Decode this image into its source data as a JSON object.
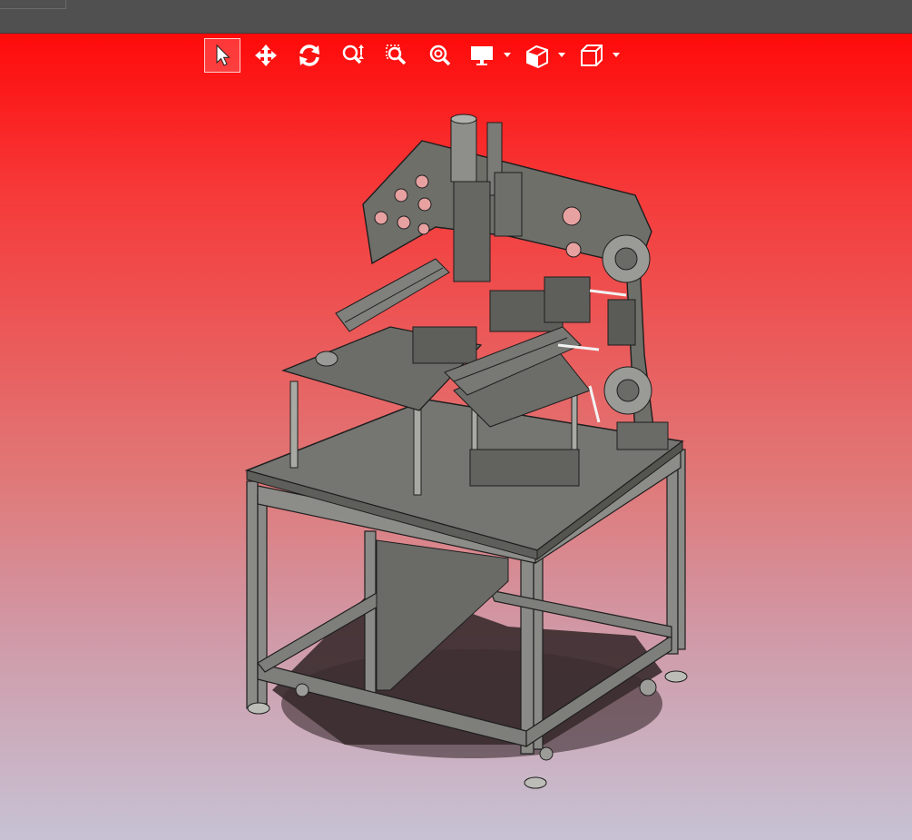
{
  "window": {
    "title_bar_color": "#505050"
  },
  "viewport": {
    "background_top": "#ff0a0a",
    "background_bottom": "#c6c2d4"
  },
  "toolbar": {
    "tools": [
      {
        "name": "select-tool",
        "icon": "cursor-arrow-icon",
        "active": true
      },
      {
        "name": "pan-tool",
        "icon": "move-arrows-icon",
        "active": false
      },
      {
        "name": "rotate-tool",
        "icon": "rotate-icon",
        "active": false
      },
      {
        "name": "zoom-in-out-tool",
        "icon": "zoom-in-out-icon",
        "active": false
      },
      {
        "name": "zoom-window-tool",
        "icon": "zoom-window-icon",
        "active": false
      },
      {
        "name": "zoom-fit-tool",
        "icon": "zoom-fit-icon",
        "active": false
      },
      {
        "name": "display-style-dropdown",
        "icon": "monitor-icon",
        "active": false
      },
      {
        "name": "section-view-dropdown",
        "icon": "section-view-icon",
        "active": false
      },
      {
        "name": "view-orientation-dropdown",
        "icon": "cube-icon",
        "active": false
      }
    ]
  },
  "model": {
    "description_icon": "machine-assembly-model",
    "body_color": "#6f6f6a",
    "edge_color": "#1e1e1e",
    "shadow_color": "#3a2b2e"
  }
}
